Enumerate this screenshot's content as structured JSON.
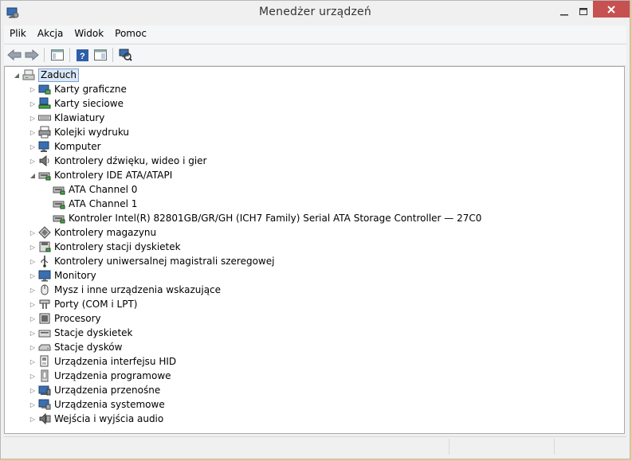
{
  "window": {
    "title": "Menedżer urządzeń"
  },
  "menu": {
    "items": [
      "Plik",
      "Akcja",
      "Widok",
      "Pomoc"
    ]
  },
  "tree": {
    "root": "Zaduch",
    "categories": [
      {
        "label": "Karty graficzne",
        "icon": "display-adapter-icon"
      },
      {
        "label": "Karty sieciowe",
        "icon": "network-adapter-icon"
      },
      {
        "label": "Klawiatury",
        "icon": "keyboard-icon"
      },
      {
        "label": "Kolejki wydruku",
        "icon": "printer-icon"
      },
      {
        "label": "Komputer",
        "icon": "computer-icon"
      },
      {
        "label": "Kontrolery dźwięku, wideo i gier",
        "icon": "speaker-icon"
      },
      {
        "label": "Kontrolery IDE ATA/ATAPI",
        "icon": "ide-controller-icon",
        "expanded": true,
        "children": [
          {
            "label": "ATA Channel 0",
            "icon": "ide-controller-icon"
          },
          {
            "label": "ATA Channel 1",
            "icon": "ide-controller-icon"
          },
          {
            "label": "Kontroler Intel(R) 82801GB/GR/GH (ICH7 Family) Serial ATA Storage Controller — 27C0",
            "icon": "ide-controller-icon"
          }
        ]
      },
      {
        "label": "Kontrolery magazynu",
        "icon": "storage-controller-icon"
      },
      {
        "label": "Kontrolery stacji dyskietek",
        "icon": "floppy-controller-icon"
      },
      {
        "label": "Kontrolery uniwersalnej magistrali szeregowej",
        "icon": "usb-icon"
      },
      {
        "label": "Monitory",
        "icon": "monitor-icon"
      },
      {
        "label": "Mysz i inne urządzenia wskazujące",
        "icon": "mouse-icon"
      },
      {
        "label": "Porty (COM i LPT)",
        "icon": "port-icon"
      },
      {
        "label": "Procesory",
        "icon": "processor-icon"
      },
      {
        "label": "Stacje dyskietek",
        "icon": "floppy-drive-icon"
      },
      {
        "label": "Stacje dysków",
        "icon": "disk-drive-icon"
      },
      {
        "label": "Urządzenia interfejsu HID",
        "icon": "hid-icon"
      },
      {
        "label": "Urządzenia programowe",
        "icon": "software-device-icon"
      },
      {
        "label": "Urządzenia przenośne",
        "icon": "portable-device-icon"
      },
      {
        "label": "Urządzenia systemowe",
        "icon": "system-device-icon"
      },
      {
        "label": "Wejścia i wyjścia audio",
        "icon": "audio-io-icon"
      }
    ]
  },
  "colors": {
    "close_button": "#c75050",
    "selection": "#dbe8f7",
    "selection_border": "#7da2ce"
  }
}
